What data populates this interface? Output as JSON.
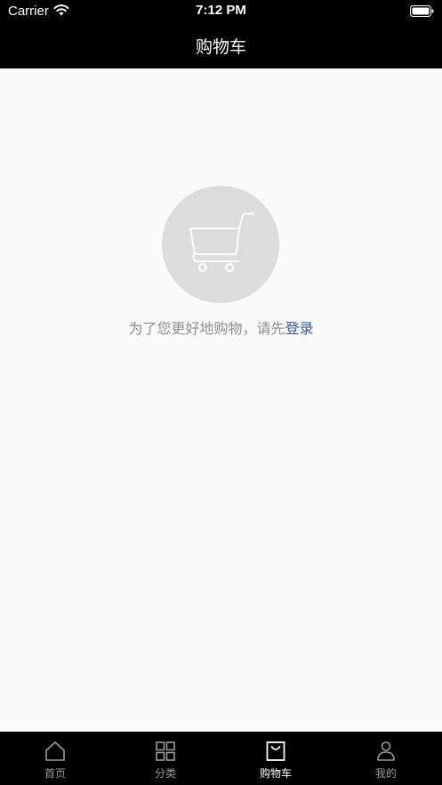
{
  "status_bar": {
    "carrier": "Carrier",
    "time": "7:12 PM"
  },
  "nav": {
    "title": "购物车"
  },
  "empty_state": {
    "message": "为了您更好地购物，请先",
    "login_link": "登录"
  },
  "tab_bar": {
    "active_index": 2,
    "tabs": [
      {
        "label": "首页",
        "icon": "home-icon"
      },
      {
        "label": "分类",
        "icon": "grid-icon"
      },
      {
        "label": "购物车",
        "icon": "shopping-bag-icon"
      },
      {
        "label": "我的",
        "icon": "user-icon"
      }
    ]
  }
}
